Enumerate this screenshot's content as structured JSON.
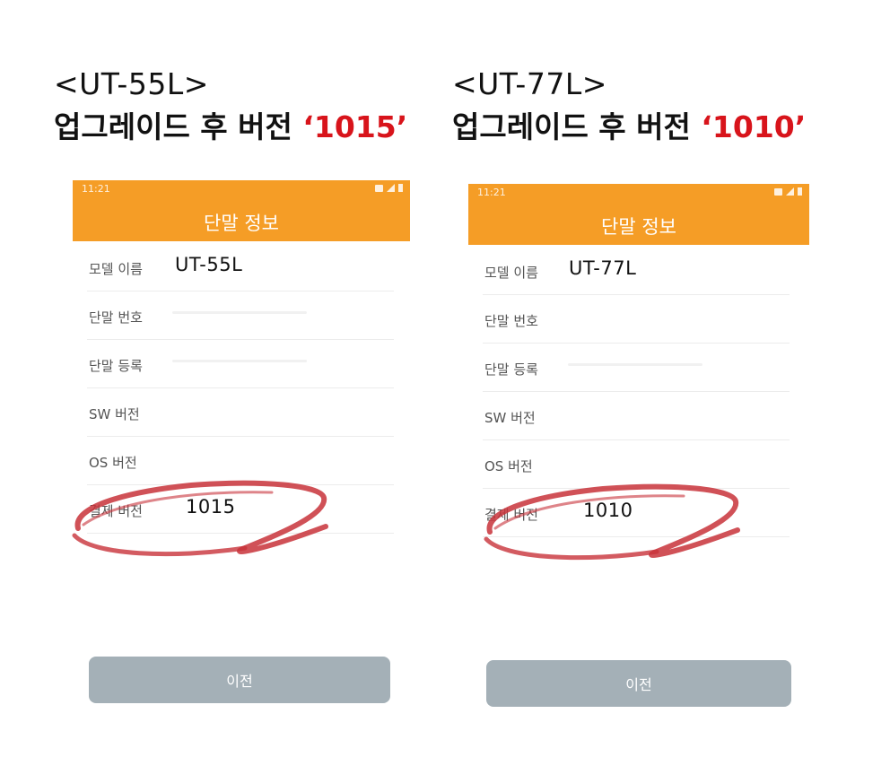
{
  "left": {
    "model_heading": "<UT-55L>",
    "upgrade_text": "업그레이드 후 버전 ",
    "upgrade_version": "‘1015’",
    "phone": {
      "status_time": "11:21",
      "title": "단말 정보",
      "rows": [
        {
          "label": "모델 이름",
          "value": "UT-55L"
        },
        {
          "label": "단말 번호",
          "value": ""
        },
        {
          "label": "단말 등록",
          "value": ""
        },
        {
          "label": "SW 버전",
          "value": ""
        },
        {
          "label": "OS 버전",
          "value": ""
        },
        {
          "label": "결제 버전",
          "value": "1015"
        }
      ],
      "prev_button": "이전"
    }
  },
  "right": {
    "model_heading": "<UT-77L>",
    "upgrade_text": "업그레이드 후 버전 ",
    "upgrade_version": "‘1010’",
    "phone": {
      "status_time": "11:21",
      "title": "단말 정보",
      "rows": [
        {
          "label": "모델 이름",
          "value": "UT-77L"
        },
        {
          "label": "단말 번호",
          "value": ""
        },
        {
          "label": "단말 등록",
          "value": ""
        },
        {
          "label": "SW 버전",
          "value": ""
        },
        {
          "label": "OS 버전",
          "value": ""
        },
        {
          "label": "결제 버전",
          "value": "1010"
        }
      ],
      "prev_button": "이전"
    }
  },
  "colors": {
    "app_bar": "#f59d26",
    "version_highlight": "#d8141b",
    "annotation_circle": "#c8323a",
    "button": "#a4b0b7"
  }
}
